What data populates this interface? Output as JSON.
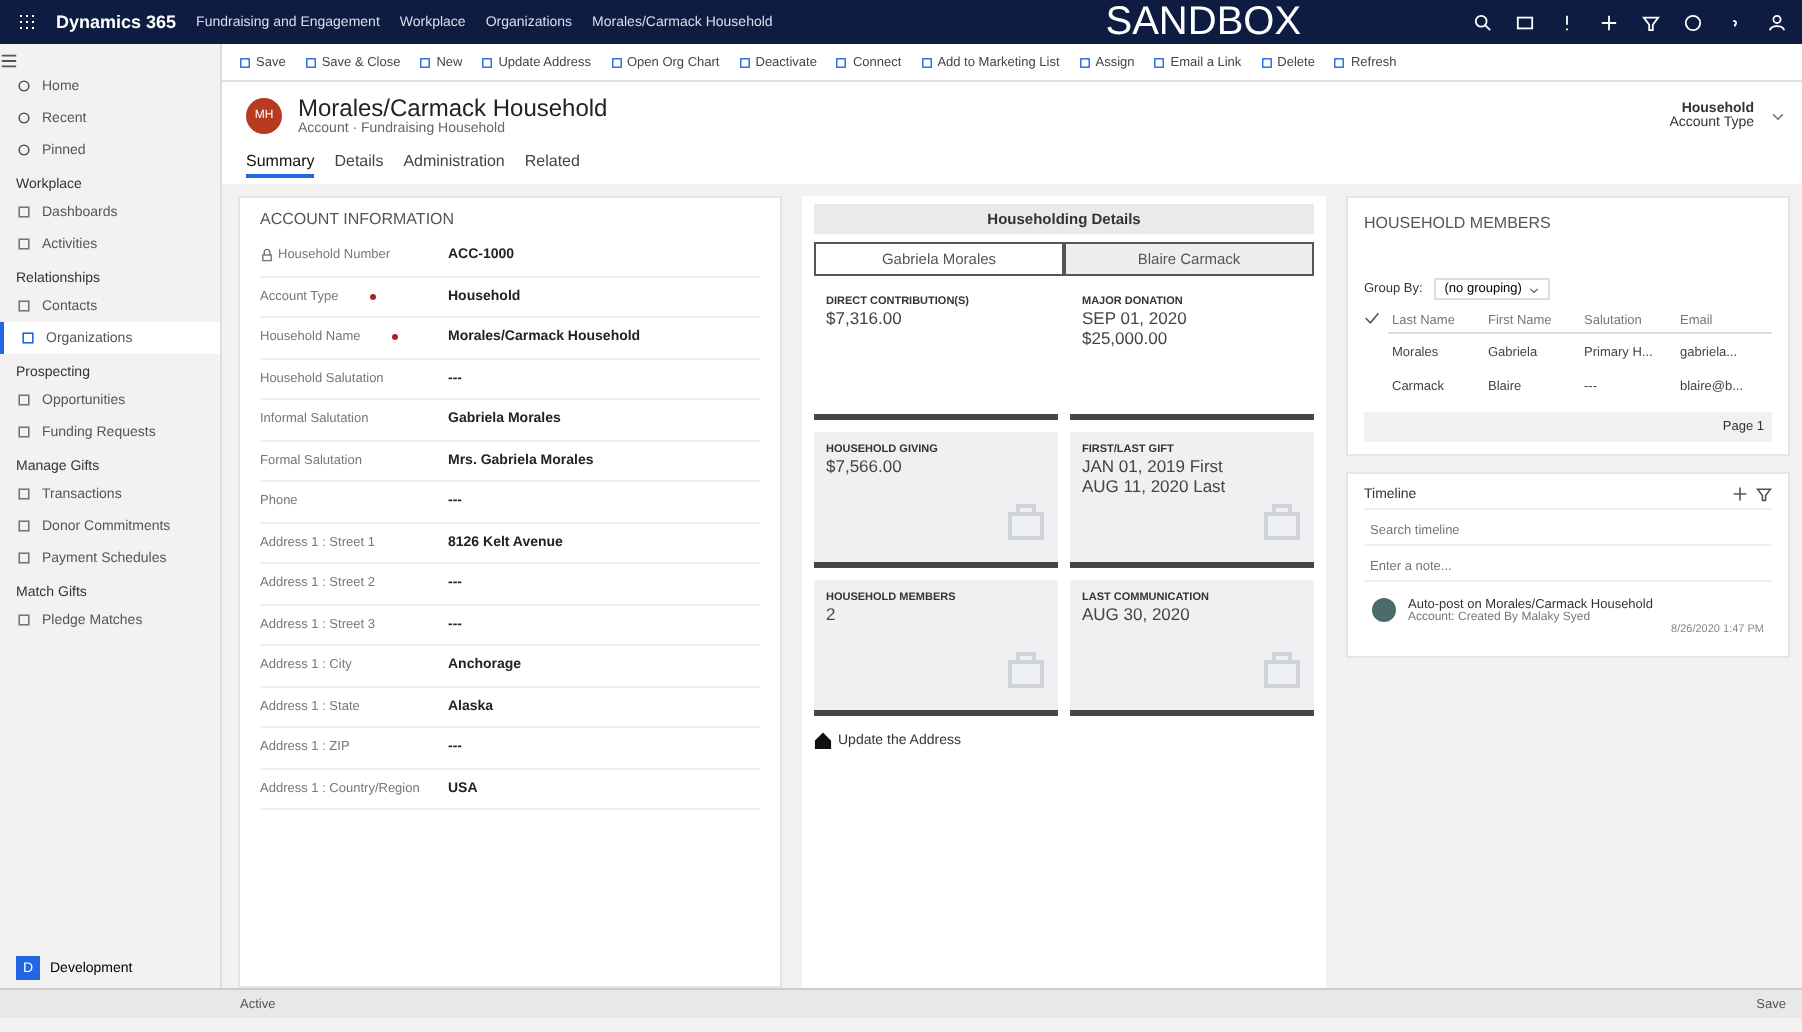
{
  "top_bar": {
    "app_name": "Dynamics 365",
    "area": "Fundraising and Engagement",
    "breadcrumbs": [
      "Workplace",
      "Organizations",
      "Morales/Carmack Household"
    ],
    "environment": "SANDBOX"
  },
  "command_bar": [
    "Save",
    "Save & Close",
    "New",
    "Update Address",
    "Open Org Chart",
    "Deactivate",
    "Connect",
    "Add to Marketing List",
    "Assign",
    "Email a Link",
    "Delete",
    "Refresh"
  ],
  "sidebar": {
    "top_items": [
      {
        "label": "Home"
      },
      {
        "label": "Recent"
      },
      {
        "label": "Pinned"
      }
    ],
    "groups": [
      {
        "title": "Workplace",
        "items": [
          {
            "label": "Dashboards",
            "selected": false
          },
          {
            "label": "Activities",
            "selected": false
          }
        ]
      },
      {
        "title": "Relationships",
        "items": [
          {
            "label": "Contacts",
            "selected": false
          },
          {
            "label": "Organizations",
            "selected": true
          }
        ]
      },
      {
        "title": "Prospecting",
        "items": [
          {
            "label": "Opportunities",
            "selected": false
          },
          {
            "label": "Funding Requests",
            "selected": false
          }
        ]
      },
      {
        "title": "Manage Gifts",
        "items": [
          {
            "label": "Transactions",
            "selected": false
          },
          {
            "label": "Donor Commitments",
            "selected": false
          },
          {
            "label": "Payment Schedules",
            "selected": false
          }
        ]
      },
      {
        "title": "Match Gifts",
        "items": [
          {
            "label": "Pledge Matches",
            "selected": false
          }
        ]
      }
    ],
    "area_switcher": {
      "badge": "D",
      "label": "Development"
    }
  },
  "record": {
    "initials": "MH",
    "title": "Morales/Carmack Household",
    "subtitle": "Account · Fundraising Household",
    "header_field": {
      "value": "Household",
      "label": "Account Type"
    }
  },
  "tabs": [
    {
      "label": "Summary",
      "selected": true
    },
    {
      "label": "Details",
      "selected": false
    },
    {
      "label": "Administration",
      "selected": false
    },
    {
      "label": "Related",
      "selected": false
    }
  ],
  "account_information": {
    "title": "ACCOUNT INFORMATION",
    "fields": [
      {
        "label": "Household Number",
        "value": "ACC-1000",
        "locked": true,
        "required": false
      },
      {
        "label": "Account Type",
        "value": "Household",
        "locked": false,
        "required": true
      },
      {
        "label": "Household Name",
        "value": "Morales/Carmack Household",
        "locked": false,
        "required": true
      },
      {
        "label": "Household Salutation",
        "value": "---",
        "locked": false,
        "required": false
      },
      {
        "label": "Informal Salutation",
        "value": "Gabriela Morales",
        "locked": false,
        "required": false
      },
      {
        "label": "Formal Salutation",
        "value": "Mrs. Gabriela Morales",
        "locked": false,
        "required": false
      },
      {
        "label": "Phone",
        "value": "---",
        "locked": false,
        "required": false
      },
      {
        "label": "Address 1 : Street 1",
        "value": "8126 Kelt Avenue",
        "locked": false,
        "required": false
      },
      {
        "label": "Address 1 : Street 2",
        "value": "---",
        "locked": false,
        "required": false
      },
      {
        "label": "Address 1 : Street 3",
        "value": "---",
        "locked": false,
        "required": false
      },
      {
        "label": "Address 1 : City",
        "value": "Anchorage",
        "locked": false,
        "required": false
      },
      {
        "label": "Address 1 : State",
        "value": "Alaska",
        "locked": false,
        "required": false
      },
      {
        "label": "Address 1 : ZIP",
        "value": "---",
        "locked": false,
        "required": false
      },
      {
        "label": "Address 1 : Country/Region",
        "value": "USA",
        "locked": false,
        "required": false
      }
    ]
  },
  "householding_details": {
    "title": "Householding Details",
    "members": [
      {
        "label": "Gabriela Morales",
        "selected": true
      },
      {
        "label": "Blaire Carmack",
        "selected": false
      }
    ],
    "cards": [
      {
        "kind": "plain",
        "label": "DIRECT CONTRIBUTION(S)",
        "lines": [
          "$7,316.00"
        ]
      },
      {
        "kind": "plain",
        "label": "MAJOR DONATION",
        "lines": [
          "SEP 01, 2020",
          "$25,000.00"
        ]
      },
      {
        "kind": "icon",
        "label": "HOUSEHOLD GIVING",
        "lines": [
          "$7,566.00"
        ]
      },
      {
        "kind": "icon",
        "label": "FIRST/LAST GIFT",
        "lines": [
          "JAN 01, 2019 First",
          "AUG 11, 2020 Last"
        ]
      },
      {
        "kind": "icon",
        "label": "HOUSEHOLD MEMBERS",
        "lines": [
          "2"
        ]
      },
      {
        "kind": "icon",
        "label": "LAST COMMUNICATION",
        "lines": [
          "AUG 30, 2020"
        ]
      }
    ],
    "link": "Update the Address"
  },
  "household_members": {
    "title": "HOUSEHOLD MEMBERS",
    "group_by_label": "Group By:",
    "group_by_value": "(no grouping)",
    "columns": [
      "Last Name",
      "First Name",
      "Salutation",
      "Email"
    ],
    "rows": [
      [
        "Morales",
        "Gabriela",
        "Primary H...",
        "gabriela..."
      ],
      [
        "Carmack",
        "Blaire",
        "---",
        "blaire@b..."
      ]
    ],
    "pager": "Page 1"
  },
  "timeline": {
    "title": "Timeline",
    "search_placeholder": "Search timeline",
    "note_placeholder": "Enter a note...",
    "entries": [
      {
        "title": "Auto-post on Morales/Carmack Household",
        "detail": "Account: Created By Malaky Syed",
        "time": "8/26/2020 1:47 PM"
      }
    ]
  },
  "status_bar": {
    "state": "Active",
    "save": "Save"
  }
}
